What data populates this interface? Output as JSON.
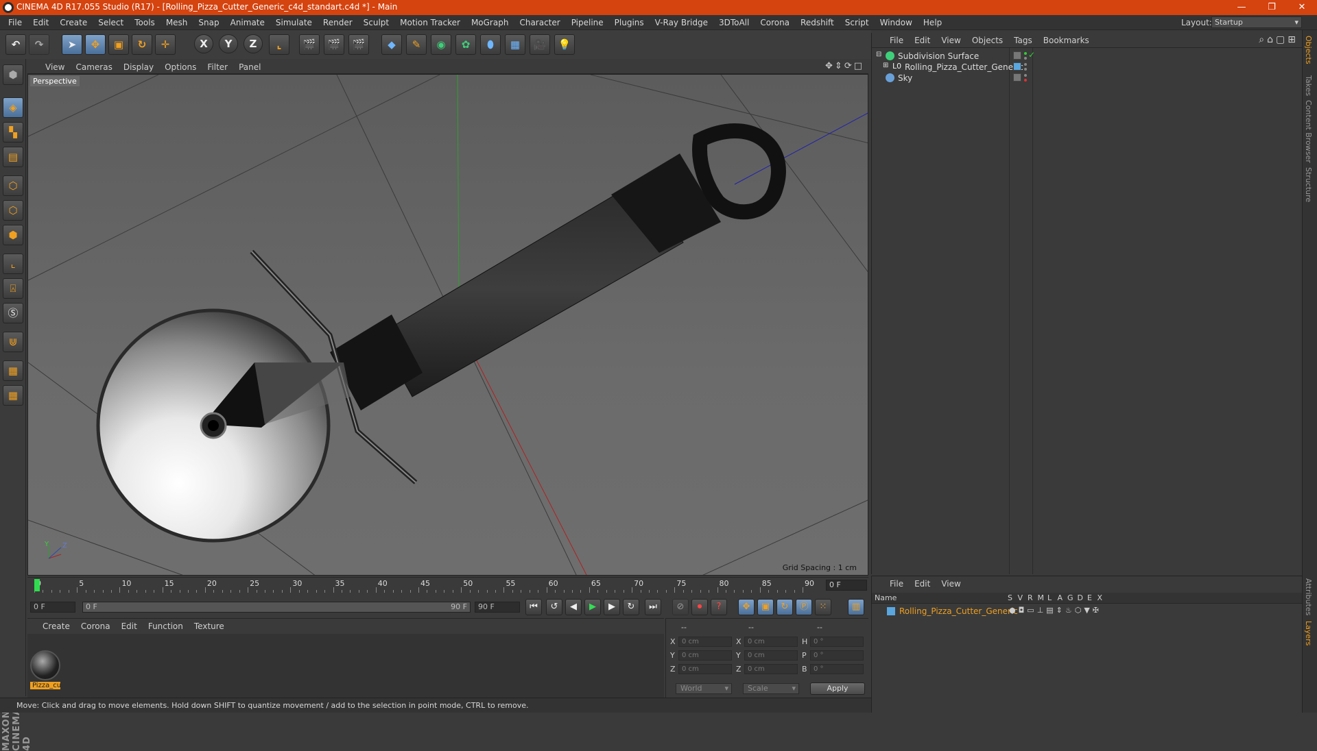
{
  "window": {
    "title": "CINEMA 4D R17.055 Studio (R17) - [Rolling_Pizza_Cutter_Generic_c4d_standart.c4d *] - Main",
    "minimize": "—",
    "restore": "❐",
    "close": "✕"
  },
  "menubar": {
    "items": [
      "File",
      "Edit",
      "Create",
      "Select",
      "Tools",
      "Mesh",
      "Snap",
      "Animate",
      "Simulate",
      "Render",
      "Sculpt",
      "Motion Tracker",
      "MoGraph",
      "Character",
      "Pipeline",
      "Plugins",
      "V-Ray Bridge",
      "3DToAll",
      "Corona",
      "Redshift",
      "Script",
      "Window",
      "Help"
    ],
    "layout_label": "Layout:",
    "layout_value": "Startup"
  },
  "toolbar": {
    "axis_x": "X",
    "axis_y": "Y",
    "axis_z": "Z"
  },
  "viewport": {
    "menu": [
      "View",
      "Cameras",
      "Display",
      "Options",
      "Filter",
      "Panel"
    ],
    "label": "Perspective",
    "grid_spacing": "Grid Spacing : 1 cm",
    "nav_icons": "✥⇕⟳□",
    "axis_y": "Y",
    "axis_z": "Z"
  },
  "timeline": {
    "ticks": [
      "0",
      "5",
      "10",
      "15",
      "20",
      "25",
      "30",
      "35",
      "40",
      "45",
      "50",
      "55",
      "60",
      "65",
      "70",
      "75",
      "80",
      "85",
      "90"
    ],
    "current_frame": "0 F"
  },
  "transport": {
    "start_frame": "0 F",
    "range_start": "0 F",
    "range_end": "90 F",
    "end_frame": "90 F"
  },
  "material_panel": {
    "menu": [
      "Create",
      "Corona",
      "Edit",
      "Function",
      "Texture"
    ],
    "material_name": "Pizza_cu"
  },
  "coordinates": {
    "header_a": "--",
    "header_b": "--",
    "header_c": "--",
    "rows": [
      {
        "a": "X",
        "av": "0 cm",
        "b": "X",
        "bv": "0 cm",
        "c": "H",
        "cv": "0 °"
      },
      {
        "a": "Y",
        "av": "0 cm",
        "b": "Y",
        "bv": "0 cm",
        "c": "P",
        "cv": "0 °"
      },
      {
        "a": "Z",
        "av": "0 cm",
        "b": "Z",
        "bv": "0 cm",
        "c": "B",
        "cv": "0 °"
      }
    ],
    "space": "World",
    "mode": "Scale",
    "apply": "Apply"
  },
  "status": {
    "text": "Move: Click and drag to move elements. Hold down SHIFT to quantize movement / add to the selection in point mode, CTRL to remove."
  },
  "objects_panel": {
    "menu": [
      "File",
      "Edit",
      "View",
      "Objects",
      "Tags",
      "Bookmarks"
    ],
    "objects": [
      {
        "name": "Subdivision Surface"
      },
      {
        "name": "Rolling_Pizza_Cutter_Generic"
      },
      {
        "name": "Sky"
      }
    ]
  },
  "layers_panel": {
    "menu": [
      "File",
      "Edit",
      "View"
    ],
    "headers": {
      "name": "Name",
      "cols": [
        "S",
        "V",
        "R",
        "M",
        "L",
        "A",
        "G",
        "D",
        "E",
        "X"
      ]
    },
    "layer_name": "Rolling_Pizza_Cutter_Generic"
  },
  "right_tabs": [
    "Objects",
    "Takes",
    "Content Browser",
    "Structure",
    "Attributes",
    "Layers"
  ],
  "branding": "MAXON CINEMA 4D",
  "colors": {
    "titlebar": "#d5430f",
    "accent": "#f0a020",
    "selection_blue": "#4a6f99"
  }
}
